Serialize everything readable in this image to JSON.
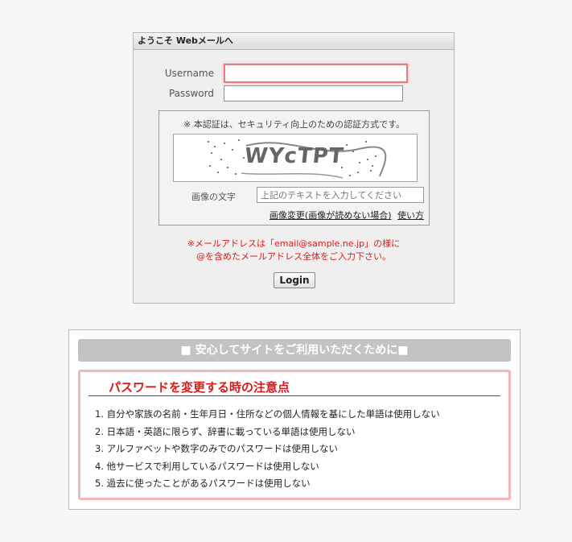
{
  "login": {
    "header": "ようこそ Webメールへ",
    "username_label": "Username",
    "password_label": "Password",
    "username_value": "",
    "password_value": "",
    "captcha": {
      "note": "※ 本認証は、セキュリティ向上のための認証方式です。",
      "image_text": "WYcTPT",
      "input_label": "画像の文字",
      "input_placeholder": "上記のテキストを入力してください",
      "change_link": "画像変更(画像が読めない場合)",
      "help_link": "使い方"
    },
    "warning_line1": "※メールアドレスは「email@sample.ne.jp」の様に",
    "warning_line2": "@を含めたメールアドレス全体をご入力下さい。",
    "login_button": "Login"
  },
  "safety": {
    "title": "■ 安心してサイトをご利用いただくために■",
    "notice_heading": "パスワードを変更する時の注意点",
    "rules": [
      "1. 自分や家族の名前・生年月日・住所などの個人情報を基にした単語は使用しない",
      "2. 日本語・英語に限らず、辞書に載っている単語は使用しない",
      "3. アルファベットや数字のみでのパスワードは使用しない",
      "4. 他サービスで利用しているパスワードは使用しない",
      "5. 過去に使ったことがあるパスワードは使用しない"
    ]
  }
}
